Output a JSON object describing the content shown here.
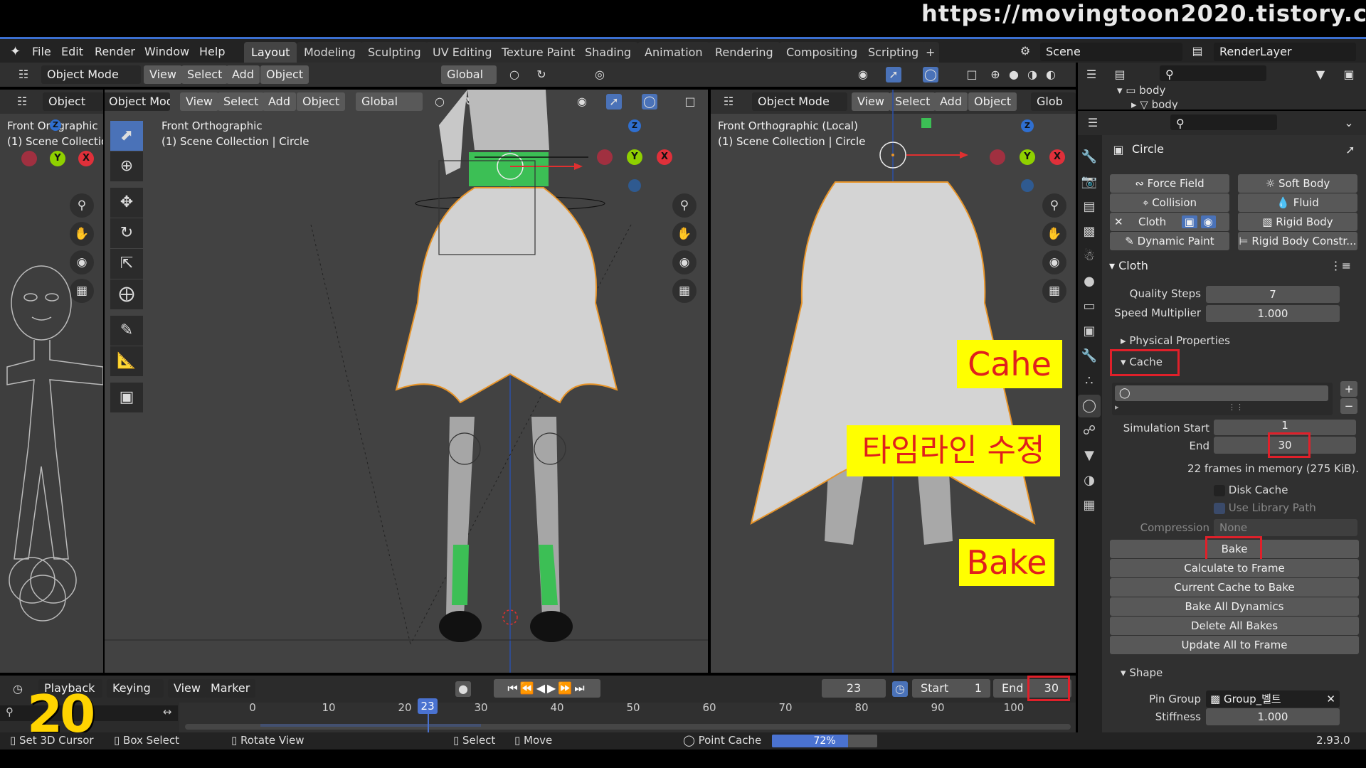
{
  "watermark": "https://movingtoon2020.tistory.com",
  "topbar": {
    "menus": [
      "File",
      "Edit",
      "Render",
      "Window",
      "Help"
    ],
    "workspaces": [
      "Layout",
      "Modeling",
      "Sculpting",
      "UV Editing",
      "Texture Paint",
      "Shading",
      "Animation",
      "Rendering",
      "Compositing",
      "Scripting"
    ],
    "active_workspace": "Layout",
    "add_tab": "+",
    "scene": "Scene",
    "render_layer": "RenderLayer"
  },
  "header_main": {
    "mode": "Object Mode",
    "view": "View",
    "select": "Select",
    "add": "Add",
    "object": "Object",
    "orientation": "Global"
  },
  "left_viewport": {
    "mode": "Object Mode",
    "label_short": "Object",
    "line1": "Front Ort   graphic",
    "line2": "(1) Scene Collectio"
  },
  "mid_viewport": {
    "mode": "Object Mode",
    "view": "View",
    "select": "Select",
    "add": "Add",
    "object": "Object",
    "orientation": "Global",
    "line1": "Front Orthographic",
    "line2": "(1) Scene Collection | Circle"
  },
  "right_viewport": {
    "mode": "Object Mode",
    "view": "View",
    "select": "Select",
    "add": "Add",
    "object": "Object",
    "orientation": "Glob",
    "line1": "Front Orthographic (Local)",
    "line2": "(1) Scene Collection | Circle"
  },
  "axes": {
    "x": "X",
    "y": "Y",
    "z": "Z"
  },
  "outliner": {
    "item1": "body",
    "item2": "body"
  },
  "properties": {
    "object_name": "Circle",
    "physics_buttons": [
      {
        "label": "Force Field",
        "icon": "force-field-icon"
      },
      {
        "label": "Soft Body",
        "icon": "soft-body-icon"
      },
      {
        "label": "Collision",
        "icon": "collision-icon"
      },
      {
        "label": "Fluid",
        "icon": "fluid-icon"
      },
      {
        "label": "Cloth",
        "icon": "close-icon"
      },
      {
        "label": "Rigid Body",
        "icon": "rigid-body-icon"
      },
      {
        "label": "Dynamic Paint",
        "icon": "dynamic-paint-icon"
      },
      {
        "label": "Rigid Body Constr...",
        "icon": "rigid-body-constraint-icon"
      }
    ],
    "cloth_panel": "Cloth",
    "quality_steps_label": "Quality Steps",
    "quality_steps_value": "7",
    "speed_multiplier_label": "Speed Multiplier",
    "speed_multiplier_value": "1.000",
    "physical_properties": "Physical Properties",
    "cache_panel": "Cache",
    "simulation_start_label": "Simulation Start",
    "simulation_start_value": "1",
    "end_label": "End",
    "end_value": "30",
    "memory_info": "22 frames in memory (275 KiB).",
    "disk_cache": "Disk Cache",
    "use_library_path": "Use Library Path",
    "compression_label": "Compression",
    "compression_value": "None",
    "bake": "Bake",
    "calculate_to_frame": "Calculate to Frame",
    "current_cache_to_bake": "Current Cache to Bake",
    "bake_all_dynamics": "Bake All Dynamics",
    "delete_all_bakes": "Delete All Bakes",
    "update_all_to_frame": "Update All to Frame",
    "shape_panel": "Shape",
    "pin_group_label": "Pin Group",
    "pin_group_value": "Group_벨트",
    "stiffness_label": "Stiffness",
    "stiffness_value": "1.000"
  },
  "annotations": {
    "cache": "Cahe",
    "timeline_edit": "타임라인 수정",
    "bake": "Bake",
    "step_number": "20"
  },
  "timeline": {
    "playback": "Playback",
    "keying": "Keying",
    "view": "View",
    "marker": "Marker",
    "current_frame": "23",
    "start_label": "Start",
    "start_value": "1",
    "end_label": "End",
    "end_value": "30",
    "ticks": [
      "0",
      "10",
      "20",
      "30",
      "40",
      "50",
      "60",
      "70",
      "80",
      "90",
      "100"
    ],
    "playhead": "23",
    "playhead_frame": 23,
    "frame_start": 1,
    "frame_end": 30
  },
  "statusbar": {
    "set_cursor": "Set 3D Cursor",
    "box_select": "Box Select",
    "rotate_view": "Rotate View",
    "select": "Select",
    "move": "Move",
    "point_cache": "Point Cache",
    "progress": "72%",
    "progress_value": 0.72,
    "version": "2.93.0"
  }
}
